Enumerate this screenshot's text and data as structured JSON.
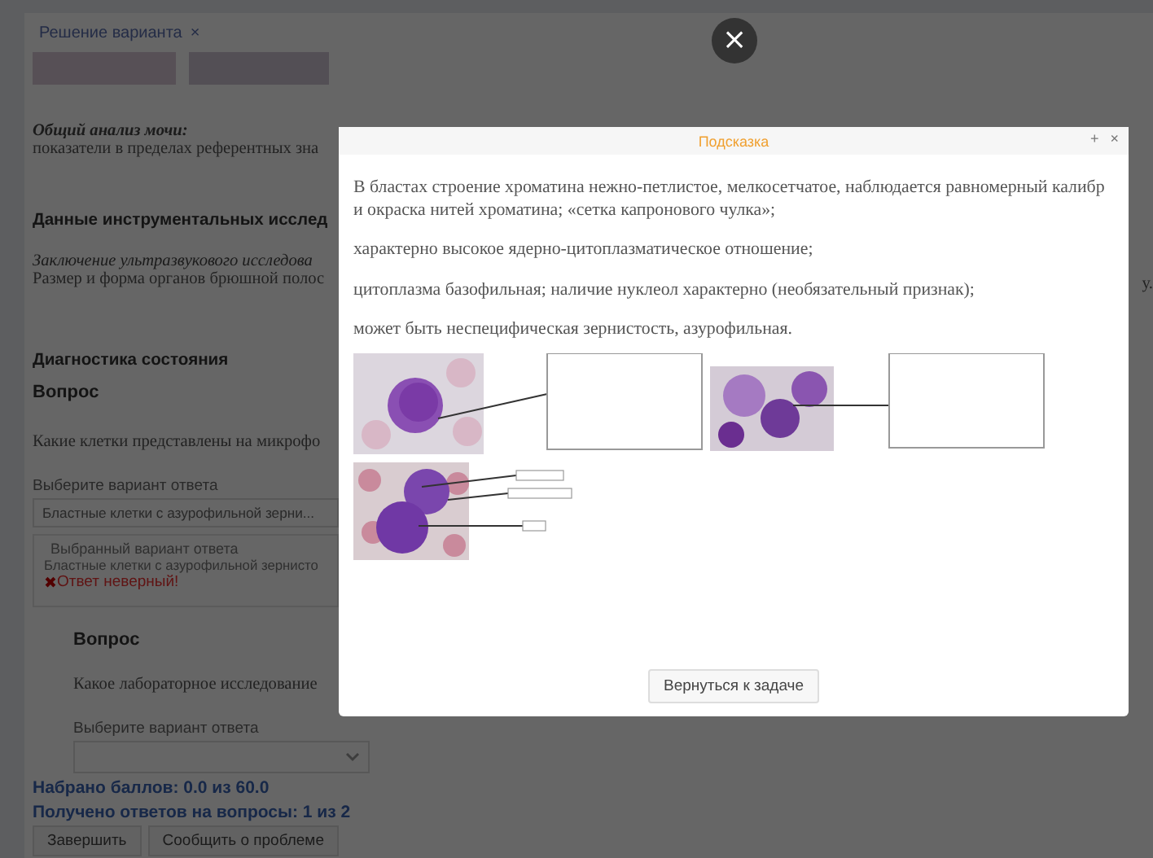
{
  "tab": {
    "label": "Решение варианта",
    "close": "×"
  },
  "lab_section": {
    "title": "Общий анализ мочи:",
    "text": "показатели в пределах референтных зна"
  },
  "instrumental": {
    "heading": "Данные инструментальных исслед",
    "subtitle": "Заключение ультразвукового исследова",
    "text": "Размер и форма органов брюшной полос",
    "text_tail": "у."
  },
  "diagnosis": {
    "heading": "Диагностика состояния",
    "questions": [
      {
        "label": "Вопрос",
        "text": "Какие клетки представлены на микрофо",
        "select_label": "Выберите вариант ответа",
        "select_value": "Бластные клетки с азурофильной зерни...",
        "answer": {
          "label": "Выбранный вариант ответа",
          "value": "Бластные клетки с азурофильной зернисто",
          "verdict_icon": "✖",
          "verdict": "Ответ неверный!"
        }
      },
      {
        "label": "Вопрос",
        "text": "Какое лабораторное исследование",
        "select_label": "Выберите вариант ответа"
      }
    ]
  },
  "score": "Набрано баллов: 0.0 из 60.0",
  "answered": "Получено ответов на вопросы: 1 из 2",
  "buttons": [
    "Завершить",
    "Сообщить о проблеме"
  ],
  "overlay_close": "×",
  "modal": {
    "title": "Подсказка",
    "expand": "+",
    "close": "×",
    "paragraphs": [
      "В бластах строение хроматина нежно-петлистое, мелкосетчатое, наблюдается  равномерный калибр и окраска нитей хроматина; «сетка капронового чулка»;",
      "характерно высокое ядерно-цитоплазматическое отношение;",
      "цитоплазма базофильная; наличие нуклеол характерно (необязательный признак);",
      "может быть неспецифическая зернистость, азурофильная."
    ],
    "button": "Вернуться к задаче"
  }
}
